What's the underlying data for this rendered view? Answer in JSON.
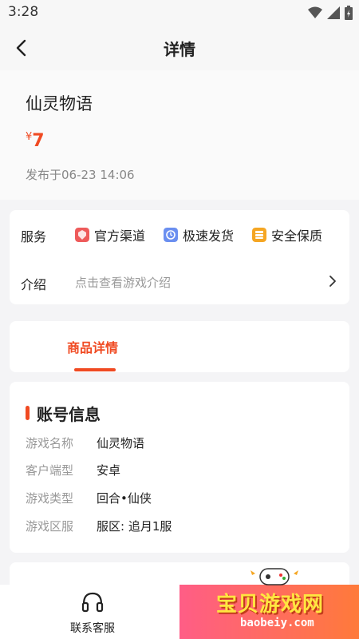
{
  "status_bar": {
    "time": "3:28"
  },
  "header": {
    "title": "详情"
  },
  "product": {
    "name": "仙灵物语",
    "price_symbol": "¥",
    "price": "7",
    "published": "发布于06-23 14:06"
  },
  "services": {
    "label": "服务",
    "items": [
      {
        "label": "官方渠道",
        "icon": "shield-icon",
        "color": "#ee5b5b"
      },
      {
        "label": "极速发货",
        "icon": "clock-icon",
        "color": "#6b8ff0"
      },
      {
        "label": "安全保质",
        "icon": "database-icon",
        "color": "#f5a623"
      }
    ]
  },
  "intro": {
    "label": "介绍",
    "hint": "点击查看游戏介绍"
  },
  "tabs": {
    "active": "商品详情"
  },
  "account_info": {
    "title": "账号信息",
    "rows": [
      {
        "key": "游戏名称",
        "value": "仙灵物语"
      },
      {
        "key": "客户端型",
        "value": "安卓"
      },
      {
        "key": "游戏类型",
        "value": "回合•仙侠"
      },
      {
        "key": "游戏区服",
        "value": "服区: 追月1服"
      }
    ]
  },
  "bottom_bar": {
    "support_label": "联系客服"
  },
  "watermark": {
    "text": "宝贝游戏网",
    "sub": "baobeiy.com"
  },
  "colors": {
    "accent": "#f04a22",
    "background": "#f4f4f6"
  }
}
